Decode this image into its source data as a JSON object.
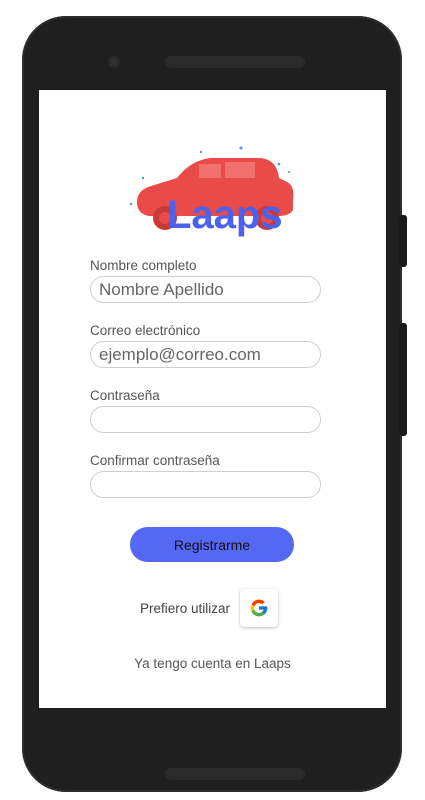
{
  "app": {
    "logo_text": "Laaps"
  },
  "form": {
    "name_label": "Nombre completo",
    "name_placeholder": "Nombre Apellido",
    "email_label": "Correo electrónico",
    "email_placeholder": "ejemplo@correo.com",
    "password_label": "Contraseña",
    "confirm_label": "Confirmar contraseña",
    "submit_label": "Registrarme"
  },
  "alt_login": {
    "prefer_text": "Prefiero utilizar",
    "provider_icon": "google-icon"
  },
  "footer": {
    "login_link": "Ya tengo cuenta en Laaps"
  },
  "colors": {
    "accent": "#5468f3",
    "logo_car": "#e94b48",
    "logo_text": "#4a61f2"
  }
}
